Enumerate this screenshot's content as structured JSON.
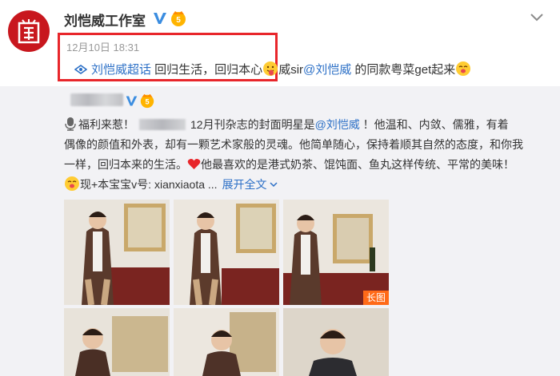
{
  "author": {
    "name": "刘恺威工作室"
  },
  "post": {
    "time": "12月10日 18:31",
    "topic": "刘恺威超话",
    "text_1": " 回归生活，回归本心",
    "text_2": "威sir",
    "mention": "@刘恺威",
    "text_3": " 的同款粤菜get起来"
  },
  "original": {
    "line1_a": "福利来惹！",
    "line1_b": "12月刊杂志的封面明星是",
    "line1_mention": "@刘恺威",
    "line1_c": " ！他温和、内敛、儒雅，有着",
    "line2": "偶像的颜值和外表，却有一颗艺术家般的灵魂。他简单随心，保持着顺其自然的态度，和你我",
    "line3_a": "一样，回归本来的生活。",
    "line3_b": "他最喜欢的是港式奶茶、馄饨面、鱼丸这样传统、平常的美味！",
    "line4_a": "现+本宝宝v号: xianxiaota ...",
    "expand_label": "展开全文",
    "long_image_tag": "长图"
  },
  "colors": {
    "link": "#2b6fc6",
    "highlight": "#e8262b",
    "repost_bg": "#f2f2f5",
    "long_tag": "#ff6a18"
  }
}
